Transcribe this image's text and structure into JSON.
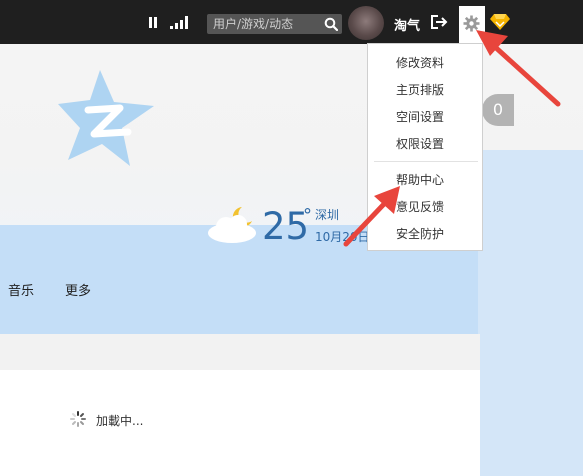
{
  "header": {
    "search_placeholder": "用户/游戏/动态",
    "nickname": "淘气",
    "icons": [
      "pause-icon",
      "signal-icon",
      "search-icon",
      "logout-icon",
      "gear-icon",
      "vip-diamond-icon"
    ]
  },
  "weather": {
    "temperature": "25",
    "degree": "°",
    "city": "深圳",
    "date": "10月20日"
  },
  "badge_count": "0",
  "nav": {
    "items": [
      "音乐",
      "更多"
    ]
  },
  "loading_text": "加載中...",
  "settings_menu": {
    "items": [
      "修改资料",
      "主页排版",
      "空间设置",
      "权限设置",
      "帮助中心",
      "意见反馈",
      "安全防护"
    ]
  },
  "colors": {
    "topbar": "#1f1f1f",
    "accent_blue": "#2f6aa6",
    "arrow_red": "#e8453c",
    "sky_band": "#c4def7",
    "vip_gold": "#f5b400"
  }
}
